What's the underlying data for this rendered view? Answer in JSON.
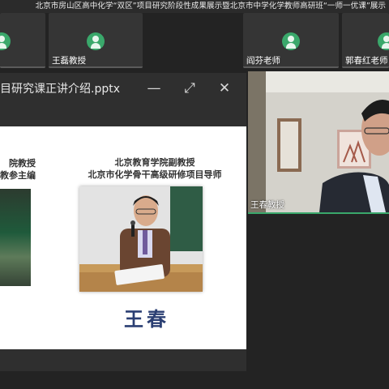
{
  "meeting": {
    "title": "北京市房山区高中化学“双区”项目研究阶段性成果展示暨北京市中学化学教师高研班“一师一优课”展示"
  },
  "participants": [
    {
      "name": ""
    },
    {
      "name": "王磊教授"
    },
    {
      "name": "阎芬老师"
    },
    {
      "name": "郭春红老师"
    }
  ],
  "presentation": {
    "filename": "目研究课正讲介绍.pptx",
    "minimize_icon": "—",
    "fullscreen_icon": "⤢",
    "close_icon": "✕",
    "slide": {
      "left_caption_lines": [
        "院教授",
        "教参主编"
      ],
      "right_caption_lines": [
        "北京教育学院副教授",
        "北京市化学骨干高级研修项目导师"
      ],
      "photo_name": "王春"
    }
  },
  "speaker": {
    "name": "王春教授"
  },
  "colors": {
    "avatar": "#3aa86b",
    "name_on_slide": "#2b3f73"
  }
}
